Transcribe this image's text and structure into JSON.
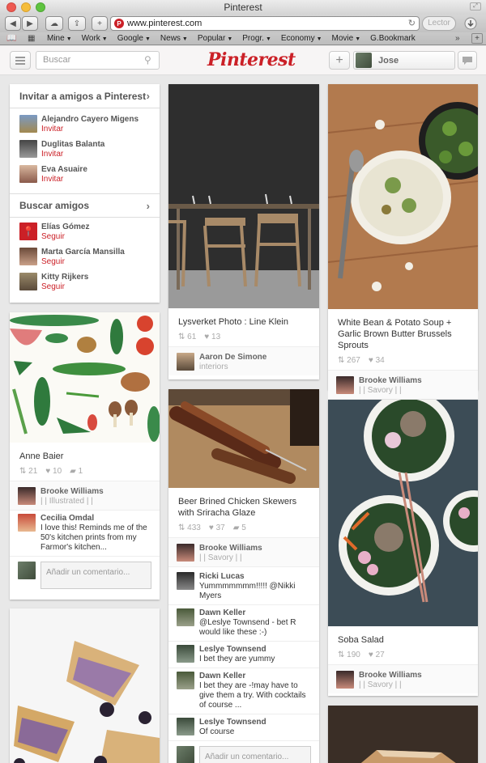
{
  "window": {
    "title": "Pinterest"
  },
  "browser": {
    "url": "www.pinterest.com",
    "reader_label": "Lector",
    "bookmarks": [
      "Mine",
      "Work",
      "Google",
      "News",
      "Popular",
      "Progr.",
      "Economy",
      "Movie",
      "G.Bookmark"
    ],
    "bookmarks_with_menu": [
      "Mine",
      "Work",
      "Google",
      "News",
      "Popular",
      "Progr.",
      "Economy",
      "Movie"
    ]
  },
  "header": {
    "search_placeholder": "Buscar",
    "logo": "Pinterest",
    "user_name": "Jose"
  },
  "sidebar": {
    "invite": {
      "title": "Invitar a amigos a Pinterest",
      "people": [
        {
          "name": "Alejandro Cayero Migens",
          "action": "Invitar"
        },
        {
          "name": "Duglitas Balanta",
          "action": "Invitar"
        },
        {
          "name": "Eva Asuaire",
          "action": "Invitar"
        }
      ]
    },
    "find": {
      "title": "Buscar amigos",
      "people": [
        {
          "name": "Elías Gómez",
          "action": "Seguir"
        },
        {
          "name": "Marta García Mansilla",
          "action": "Seguir"
        },
        {
          "name": "Kitty Rijkers",
          "action": "Seguir"
        }
      ]
    }
  },
  "pins": {
    "anne": {
      "title": "Anne Baier",
      "repins": "21",
      "likes": "10",
      "comments": "1",
      "pinner": "Brooke Williams",
      "board": "| | Illustrated | |",
      "comment_author": "Cecilia Omdal",
      "comment_text": "I love this! Reminds me of the 50's kitchen prints from my Farmor's kitchen...",
      "add_comment": "Añadir un comentario..."
    },
    "lysverket": {
      "title": "Lysverket Photo : Line Klein",
      "repins": "61",
      "likes": "13",
      "pinner": "Aaron De Simone",
      "board": "interiors"
    },
    "chicken": {
      "title": "Beer Brined Chicken Skewers with Sriracha Glaze",
      "repins": "433",
      "likes": "37",
      "comments": "5",
      "pinner": "Brooke Williams",
      "board": "| | Savory | |",
      "comments_list": [
        {
          "author": "Ricki Lucas",
          "text": "Yummmmmmm!!!!! @Nikki Myers"
        },
        {
          "author": "Dawn Keller",
          "text": "@Leslye Townsend - bet R would like these :-)"
        },
        {
          "author": "Leslye Townsend",
          "text": "I bet they are yummy"
        },
        {
          "author": "Dawn Keller",
          "text": "I bet they are -!may have to give them a try. With cocktails of course ..."
        },
        {
          "author": "Leslye Townsend",
          "text": "Of course"
        }
      ],
      "add_comment": "Añadir un comentario..."
    },
    "soup": {
      "title": "White Bean & Potato Soup + Garlic Brown Butter Brussels Sprouts",
      "repins": "267",
      "likes": "34",
      "pinner": "Brooke Williams",
      "board": "| | Savory | |"
    },
    "soba": {
      "title": "Soba Salad",
      "repins": "190",
      "likes": "27",
      "pinner": "Brooke Williams",
      "board": "| | Savory | |"
    }
  },
  "icons": {
    "repin": "pin-icon",
    "like": "heart-icon",
    "comment": "speech-bubble-icon"
  },
  "colors": {
    "brand": "#cb2027",
    "background": "#e8e8e8"
  }
}
